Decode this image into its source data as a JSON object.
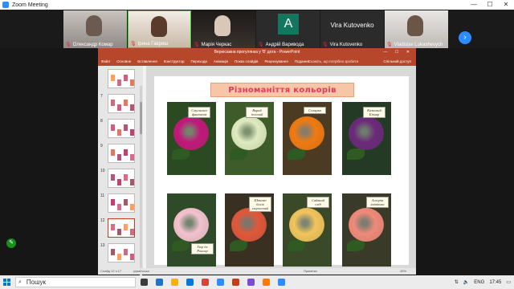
{
  "window": {
    "title": "Zoom Meeting",
    "minimize": "—",
    "maximize": "☐",
    "close": "✕"
  },
  "participants": [
    {
      "name": "Олександр Комар",
      "kind": "video1"
    },
    {
      "name": "Ірина Гавриш",
      "kind": "video2"
    },
    {
      "name": "Марія Черкас",
      "kind": "video3"
    },
    {
      "name": "Андрій Варивода",
      "kind": "avatar",
      "initial": "A"
    },
    {
      "name": "Vira Kutovenko",
      "kind": "nameonly"
    },
    {
      "name": "Vladislav Lukashevych",
      "kind": "video4"
    }
  ],
  "ppt": {
    "title": "Вернісажна прогулянка у 'В' дота - PowerPoint",
    "ribbon": [
      "Файл",
      "Основне",
      "Вставлення",
      "Конструктор",
      "Переходи",
      "Анімація",
      "Показ слайдів",
      "Рецензування",
      "Подання"
    ],
    "search": "Скажіть, що потрібно зробити",
    "share": "Спільний доступ",
    "thumb_numbers": [
      "",
      "7",
      "8",
      "9",
      "10",
      "11",
      "12",
      "13"
    ],
    "status_left": "Слайд 12 з 17",
    "status_lang": "українська",
    "status_notes": "Примітки",
    "status_zoom": "45%"
  },
  "slide": {
    "heading": "Різноманіття   кольорів",
    "roses": [
      {
        "caption": "Смугаста фантазія",
        "bloom": "#c2187a",
        "bg": "#2c4a22"
      },
      {
        "caption": "Вкрай зелений",
        "bloom": "#dfeac0",
        "bg": "#3d5c2a"
      },
      {
        "caption": "Солярка",
        "bloom": "#f07a12",
        "bg": "#4a3b22"
      },
      {
        "caption": "Казковий Бізнар",
        "bloom": "#6b2a7a",
        "bg": "#243a24"
      },
      {
        "caption": "Тюр де Ронсар",
        "bloom": "#f4c2cf",
        "bg": "#2f4a28"
      },
      {
        "caption": "Штамп богів смугастий",
        "bloom": "#e0583a",
        "bg": "#3a3022"
      },
      {
        "caption": "Сяйвний схід",
        "bloom": "#f2c45c",
        "bg": "#3a4a28"
      },
      {
        "caption": "Алегрія квіткова",
        "bloom": "#f08a7a",
        "bg": "#3a3a28"
      }
    ]
  },
  "taskbar": {
    "search_placeholder": "Пошук",
    "lang": "ENG",
    "time": "17:45",
    "apps": [
      "#3b3b3b",
      "#1e73c8",
      "#f4b400",
      "#0078d7",
      "#d44638",
      "#2d8cff",
      "#c43e1c",
      "#7b4bd6",
      "#ff7a00",
      "#2d8cff"
    ]
  }
}
